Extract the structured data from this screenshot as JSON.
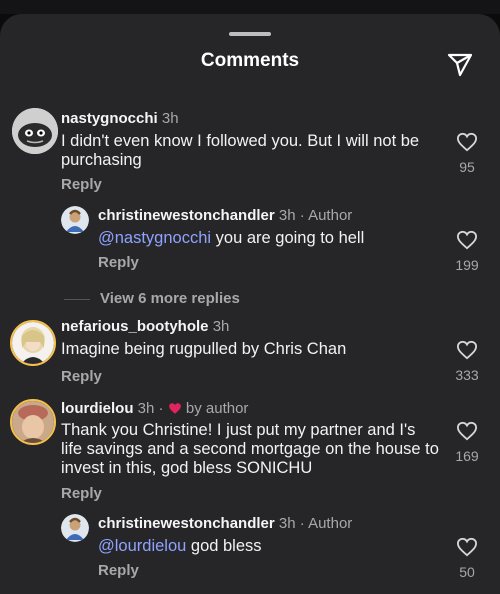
{
  "header": {
    "title": "Comments",
    "share_icon": "paper-plane-icon"
  },
  "reply_label": "Reply",
  "view_more": "View 6 more replies",
  "colors": {
    "sheet": "#262628",
    "mention": "#8fa2ff",
    "heart": "#e0245e",
    "muted": "#a8a8a8"
  },
  "comments": [
    {
      "username": "nastygnocchi",
      "time": "3h",
      "text": "I didn't even know I followed you. But I will not be purchasing",
      "likes": "95"
    },
    {
      "username": "christinewestonchandler",
      "time": "3h",
      "tag": "· Author",
      "mention": "@nastygnocchi",
      "text": " you are going to hell",
      "likes": "199"
    },
    {
      "username": "nefarious_bootyhole",
      "time": "3h",
      "text": "Imagine being rugpulled by Chris Chan",
      "likes": "333"
    },
    {
      "username": "lourdielou",
      "time": "3h",
      "tag": "· ",
      "liked_by": "by author",
      "text": "Thank you Christine! I just put my partner and I's life savings and a second mortgage on the house to invest in this, god bless SONICHU",
      "likes": "169"
    },
    {
      "username": "christinewestonchandler",
      "time": "3h",
      "tag": "· Author",
      "mention": "@lourdielou",
      "text": " god bless",
      "likes": "50"
    }
  ]
}
